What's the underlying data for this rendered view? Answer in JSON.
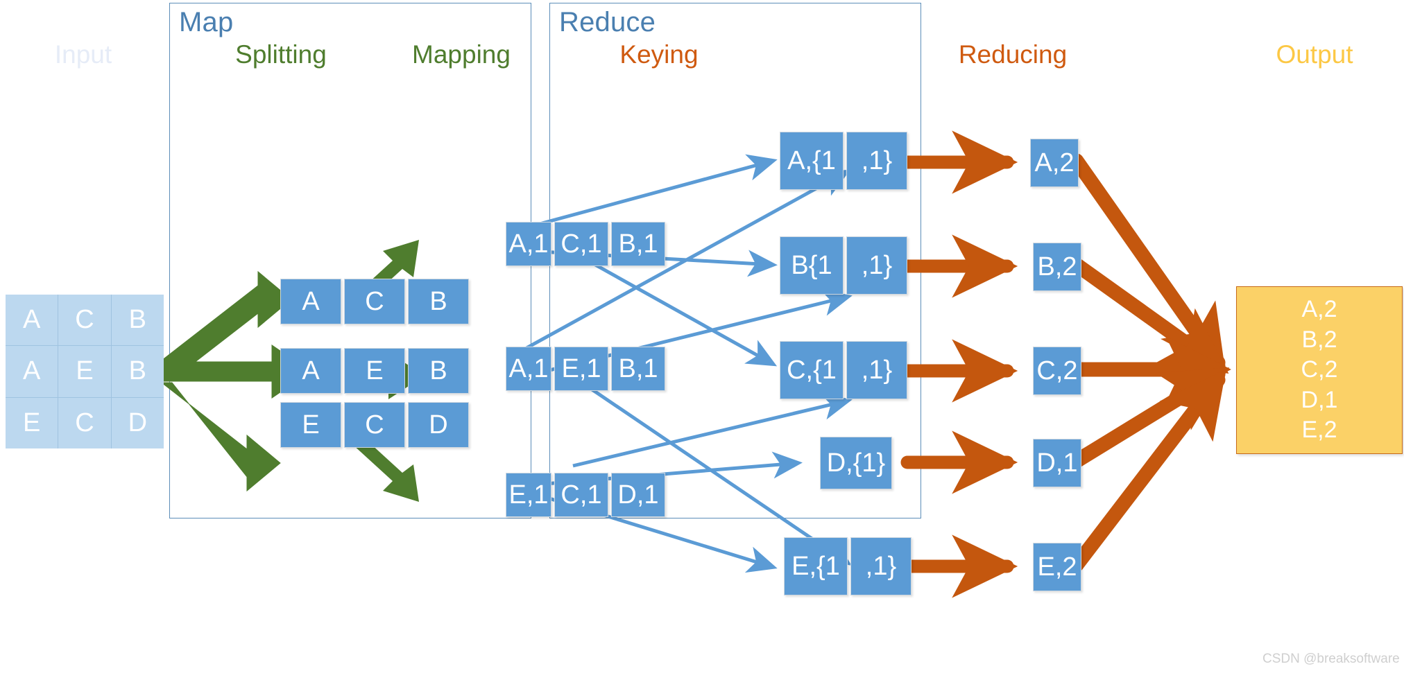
{
  "diagram": {
    "title": "MapReduce word count flow",
    "watermark": "CSDN @breaksoftware",
    "colors": {
      "panel_border": "#5b8db8",
      "panel_title": "#4a7fb0",
      "input_label": "#e6ecf7",
      "green": "#4f7d2e",
      "orange": "#cf5a10",
      "gold": "#fcc845",
      "box_fill": "#5b9bd5",
      "input_cell_fill": "#bcd8ef",
      "output_fill": "#fbd167",
      "output_border": "#c86a18",
      "connector_blue": "#5b9bd5",
      "arrow_green": "#4f7d2e",
      "arrow_orange": "#c4570e"
    }
  },
  "panels": [
    {
      "id": "map",
      "title": "Map"
    },
    {
      "id": "reduce",
      "title": "Reduce"
    }
  ],
  "columns": [
    {
      "id": "input",
      "label": "Input",
      "style": "input"
    },
    {
      "id": "splitting",
      "label": "Splitting",
      "style": "green"
    },
    {
      "id": "mapping",
      "label": "Mapping",
      "style": "green"
    },
    {
      "id": "keying",
      "label": "Keying",
      "style": "orange"
    },
    {
      "id": "reducing",
      "label": "Reducing",
      "style": "orange"
    },
    {
      "id": "output",
      "label": "Output",
      "style": "gold"
    }
  ],
  "input_grid": {
    "rows": [
      [
        "A",
        "C",
        "B"
      ],
      [
        "A",
        "E",
        "B"
      ],
      [
        "E",
        "C",
        "D"
      ]
    ]
  },
  "splitting": {
    "rows": [
      [
        "A",
        "C",
        "B"
      ],
      [
        "A",
        "E",
        "B"
      ],
      [
        "E",
        "C",
        "D"
      ]
    ]
  },
  "mapping": {
    "rows": [
      [
        "A,1",
        "C,1",
        "B,1"
      ],
      [
        "A,1",
        "E,1",
        "B,1"
      ],
      [
        "E,1",
        "C,1",
        "D,1"
      ]
    ]
  },
  "keying": {
    "rows": [
      [
        "A,{1",
        ",1}"
      ],
      [
        "B{1",
        ",1}"
      ],
      [
        "C,{1",
        ",1}"
      ],
      [
        "D,{1}"
      ],
      [
        "E,{1",
        ",1}"
      ]
    ]
  },
  "reducing": {
    "rows": [
      "A,2",
      "B,2",
      "C,2",
      "D,1",
      "E,2"
    ]
  },
  "output": {
    "lines": [
      "A,2",
      "B,2",
      "C,2",
      "D,1",
      "E,2"
    ]
  }
}
